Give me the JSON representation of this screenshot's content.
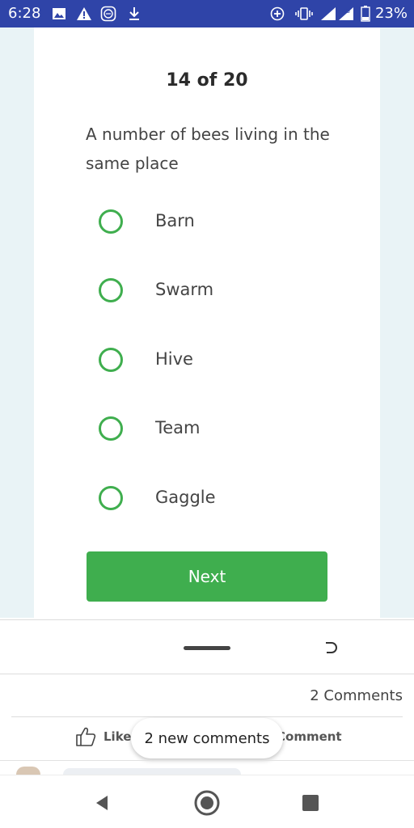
{
  "status_bar": {
    "time": "6:28",
    "battery": "23%",
    "icons": [
      "gallery-icon",
      "warning-icon",
      "messenger-icon",
      "download-icon",
      "data-saver-icon",
      "vibrate-icon",
      "signal-icon",
      "battery-icon"
    ]
  },
  "quiz": {
    "progress": "14 of 20",
    "question": "A number of bees living in the same place",
    "options": [
      "Barn",
      "Swarm",
      "Hive",
      "Team",
      "Gaggle"
    ],
    "next_label": "Next",
    "accent_color": "#3fae4e"
  },
  "comments": {
    "count_label": "2 Comments",
    "like_label": "Like",
    "comment_label": "Comment",
    "new_comments_label": "2 new comments"
  },
  "colors": {
    "status_bar_bg": "#2f44a8",
    "quiz_bg": "#e9f3f6"
  }
}
